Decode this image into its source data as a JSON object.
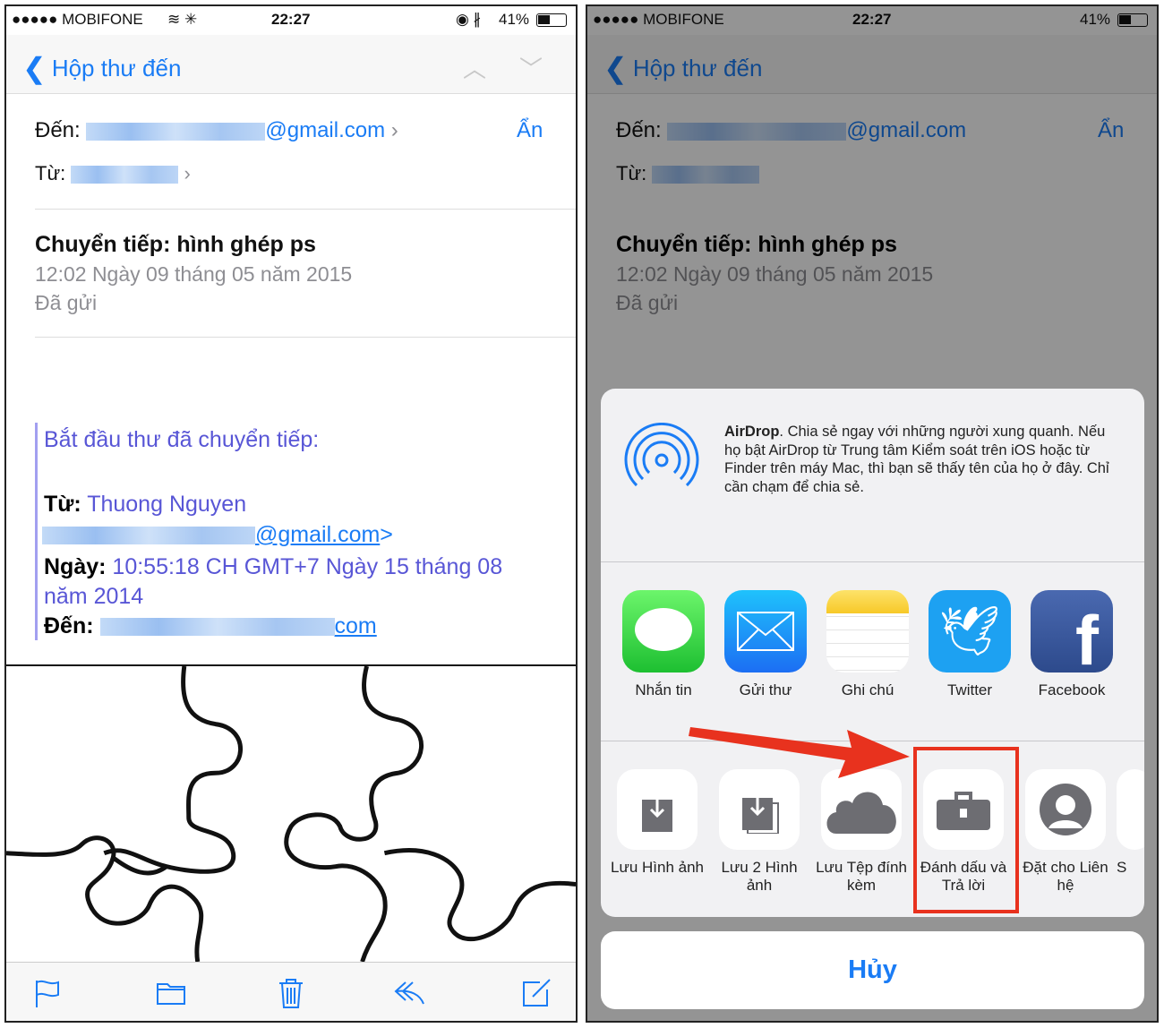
{
  "status": {
    "carrier": "●●●●● MOBIFONE",
    "time": "22:27",
    "battery": "41%"
  },
  "nav": {
    "back_label": "Hộp thư đến"
  },
  "header": {
    "to_label": "Đến:",
    "to_email_suffix": "@gmail.com",
    "hide_label": "Ẩn",
    "from_label": "Từ:"
  },
  "message": {
    "subject": "Chuyển tiếp: hình ghép ps",
    "date": "12:02 Ngày 09 tháng 05 năm 2015",
    "folder": "Đã gửi"
  },
  "forwarded": {
    "intro": "Bắt đầu thư đã chuyển tiếp:",
    "from_label": "Từ:",
    "from_name": "Thuong Nguyen",
    "from_email_suffix": "@gmail.com",
    "date_label": "Ngày:",
    "date_value": "10:55:18 CH GMT+7 Ngày 15 tháng 08 năm 2014",
    "to_label": "Đến:",
    "to_email_suffix": "com"
  },
  "share_sheet": {
    "airdrop_title": "AirDrop",
    "airdrop_text": ". Chia sẻ ngay với những người xung quanh. Nếu họ bật AirDrop từ Trung tâm Kiểm soát trên iOS hoặc từ Finder trên máy Mac, thì bạn sẽ thấy tên của họ ở đây. Chỉ cần chạm để chia sẻ.",
    "apps": [
      {
        "label": "Nhắn tin",
        "icon": "messages-icon"
      },
      {
        "label": "Gửi thư",
        "icon": "mail-icon"
      },
      {
        "label": "Ghi chú",
        "icon": "notes-icon"
      },
      {
        "label": "Twitter",
        "icon": "twitter-icon"
      },
      {
        "label": "Facebook",
        "icon": "facebook-icon"
      }
    ],
    "actions": [
      {
        "label": "Lưu Hình ảnh",
        "icon": "save-image-icon"
      },
      {
        "label": "Lưu 2 Hình ảnh",
        "icon": "save-images-icon"
      },
      {
        "label": "Lưu Tệp đính kèm",
        "icon": "cloud-icon"
      },
      {
        "label": "Đánh dấu và Trả lời",
        "icon": "toolbox-icon"
      },
      {
        "label": "Đặt cho Liên hệ",
        "icon": "contact-icon"
      },
      {
        "label": "S"
      }
    ],
    "cancel_label": "Hủy"
  },
  "colors": {
    "accent": "#1a7cf5",
    "highlight": "#e8321e",
    "quote": "#5856d6"
  }
}
